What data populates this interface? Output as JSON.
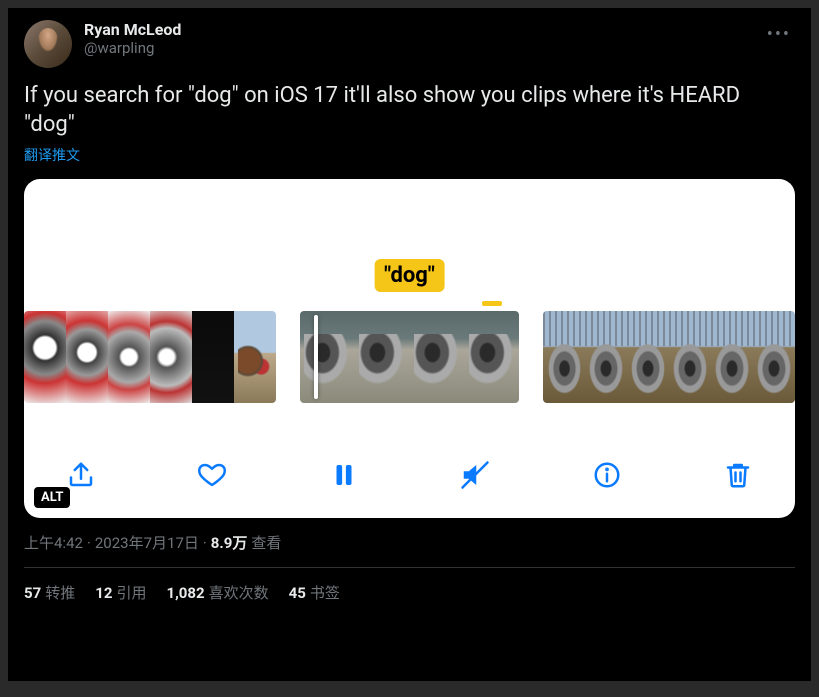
{
  "author": {
    "display_name": "Ryan McLeod",
    "handle": "@warpling"
  },
  "tweet_text": "If you search for \"dog\" on iOS 17 it'll also show you clips where it's HEARD \"dog\"",
  "translate_label": "翻译推文",
  "media": {
    "caption_token": "\"dog\"",
    "alt_badge": "ALT",
    "toolbar": {
      "share": "share",
      "like": "like",
      "pause": "pause",
      "mute": "mute",
      "info": "info",
      "delete": "delete"
    }
  },
  "meta": {
    "time": "上午4:42",
    "date": "2023年7月17日",
    "views_count": "8.9万",
    "views_label": "查看"
  },
  "stats": {
    "retweets_count": "57",
    "retweets_label": "转推",
    "quotes_count": "12",
    "quotes_label": "引用",
    "likes_count": "1,082",
    "likes_label": "喜欢次数",
    "bookmarks_count": "45",
    "bookmarks_label": "书签"
  },
  "more_label": "•••"
}
